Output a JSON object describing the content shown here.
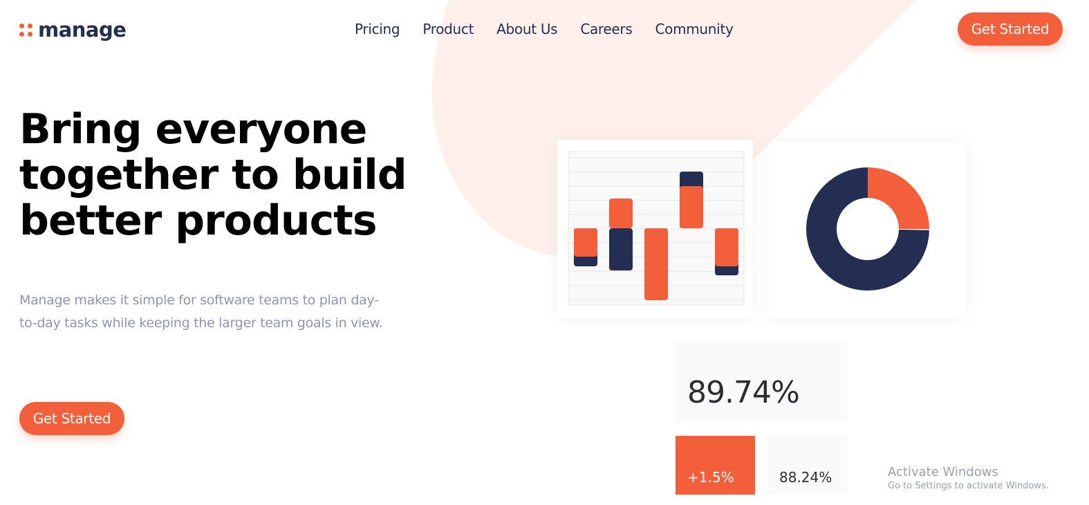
{
  "brand": {
    "name": "manage",
    "accent_color": "#f25f3a",
    "dark_color": "#242d52",
    "soft_bg_color": "#fff0ec"
  },
  "nav": {
    "items": [
      "Pricing",
      "Product",
      "About Us",
      "Careers",
      "Community"
    ]
  },
  "header": {
    "cta_label": "Get Started"
  },
  "hero": {
    "title": "Bring everyone together to build better products",
    "description": "Manage makes it simple for software teams to plan day-to-day tasks while keeping the larger team goals in view.",
    "cta_label": "Get Started"
  },
  "dashboard": {
    "bar_widget": {
      "bars": [
        {
          "orange": -0.41,
          "navy": -0.55
        },
        {
          "orange": 0.43,
          "navy": -0.61
        },
        {
          "orange": -1.04,
          "navy": -0.41
        },
        {
          "orange": 0.61,
          "navy": 0.82
        },
        {
          "orange": -0.55,
          "navy": -0.68
        }
      ]
    },
    "donut_widget": {
      "segments": [
        {
          "label": "orange",
          "value": 25,
          "color": "#f25f3a"
        },
        {
          "label": "navy",
          "value": 75,
          "color": "#242d52"
        }
      ]
    },
    "stat_main": "89.74%",
    "stat_change": "+1.5%",
    "stat_secondary": "88.24%"
  },
  "watermark": {
    "title": "Activate Windows",
    "subtitle": "Go to Settings to activate Windows."
  }
}
